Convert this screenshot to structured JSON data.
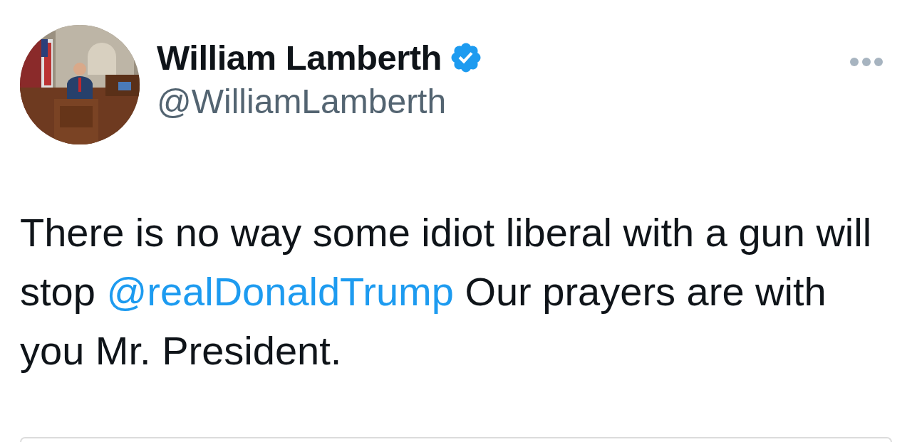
{
  "author": {
    "name": "William Lamberth",
    "verified": true,
    "handle": "@WilliamLamberth"
  },
  "tweet": {
    "text_before": "There is no way some idiot liberal with a gun will stop",
    "mention": "@realDonaldTrump",
    "text_after": "Our prayers are with you Mr. President."
  }
}
